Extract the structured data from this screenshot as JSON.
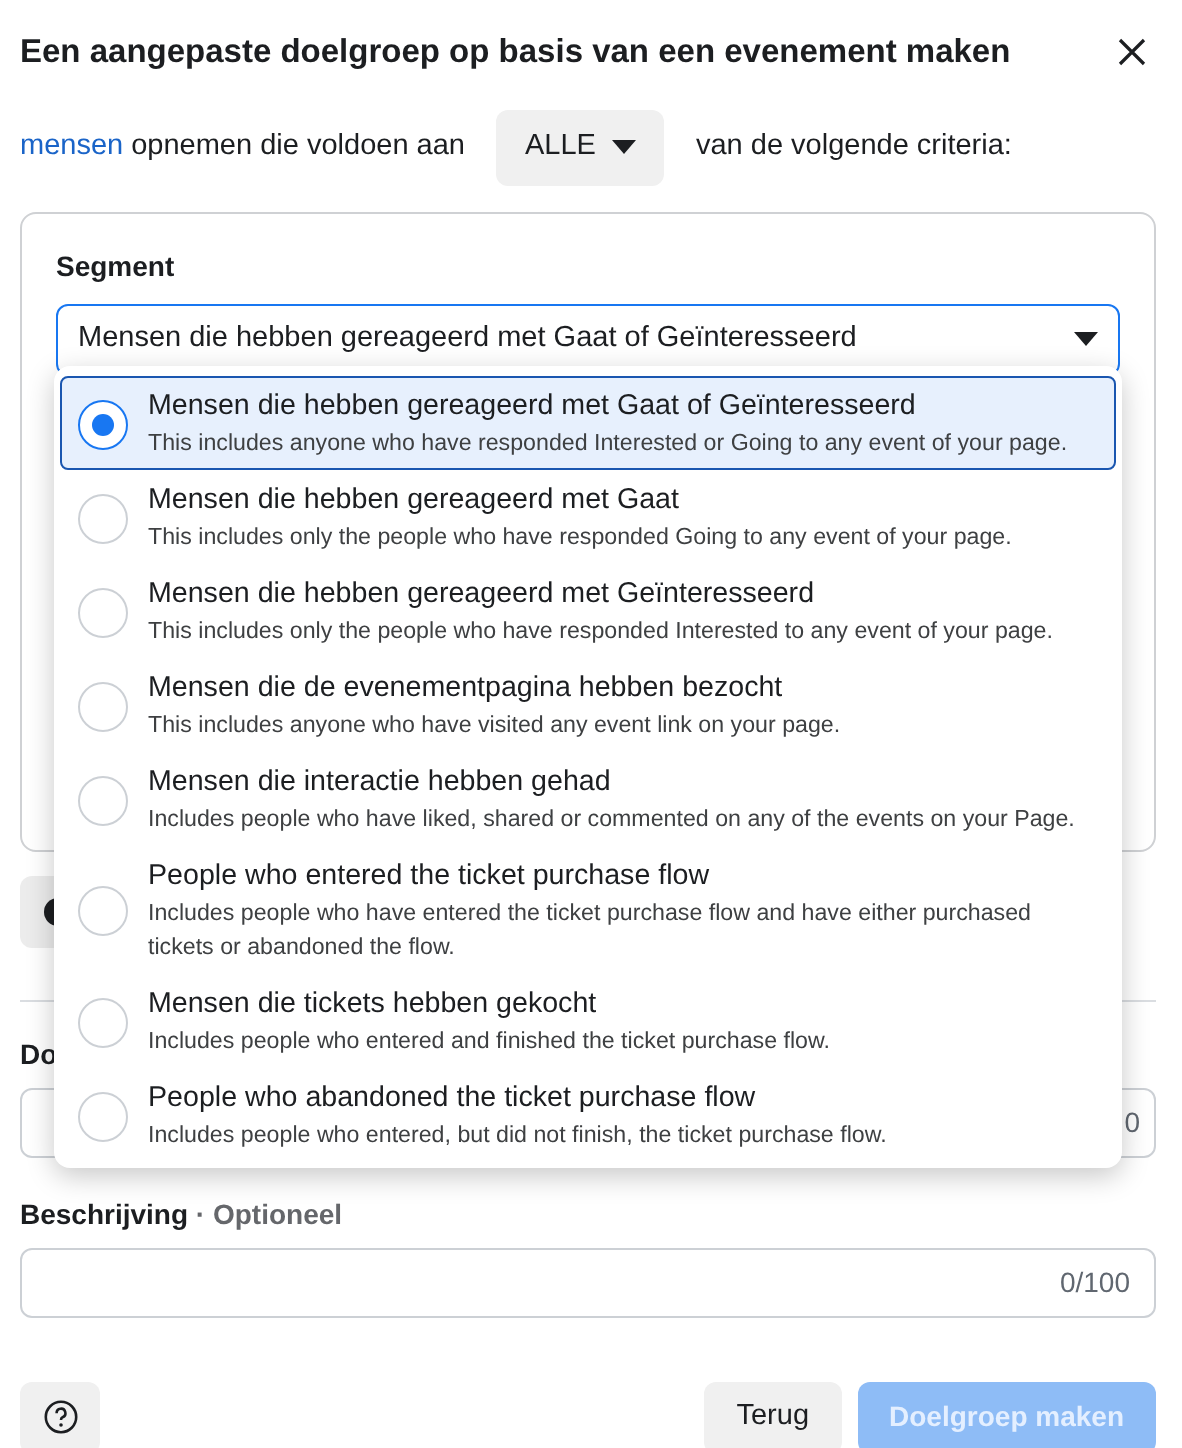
{
  "dialog": {
    "title": "Een aangepaste doelgroep op basis van een evenement maken"
  },
  "criteria": {
    "link": "mensen",
    "text_before": "opnemen die voldoen aan",
    "match": "ALLE",
    "text_after": "van de volgende criteria:"
  },
  "segment": {
    "label": "Segment",
    "value": "Mensen die hebben gereageerd met Gaat of Geïnteresseerd",
    "expanded": true,
    "options": [
      {
        "title": "Mensen die hebben gereageerd met Gaat of Geïnteresseerd",
        "description": "This includes anyone who have responded Interested or Going to any event of your page.",
        "selected": true
      },
      {
        "title": "Mensen die hebben gereageerd met Gaat",
        "description": "This includes only the people who have responded Going to any event of your page.",
        "selected": false
      },
      {
        "title": "Mensen die hebben gereageerd met Geïnteresseerd",
        "description": "This includes only the people who have responded Interested to any event of your page.",
        "selected": false
      },
      {
        "title": "Mensen die de evenementpagina hebben bezocht",
        "description": "This includes anyone who have visited any event link on your page.",
        "selected": false
      },
      {
        "title": "Mensen die interactie hebben gehad",
        "description": "Includes people who have liked, shared or commented on any of the events on your Page.",
        "selected": false
      },
      {
        "title": "People who entered the ticket purchase flow",
        "description": "Includes people who have entered the ticket purchase flow and have either purchased tickets or abandoned the flow.",
        "selected": false
      },
      {
        "title": "Mensen die tickets hebben gekocht",
        "description": "Includes people who entered and finished the ticket purchase flow.",
        "selected": false
      },
      {
        "title": "People who abandoned the ticket purchase flow",
        "description": "Includes people who entered, but did not finish, the ticket purchase flow.",
        "selected": false
      }
    ]
  },
  "name_field": {
    "label": "Do",
    "counter": "0"
  },
  "description_field": {
    "label": "Beschrijving",
    "optional": "· Optioneel",
    "counter": "0/100"
  },
  "footer": {
    "back": "Terug",
    "create": "Doelgroep maken",
    "create_disabled": true
  }
}
